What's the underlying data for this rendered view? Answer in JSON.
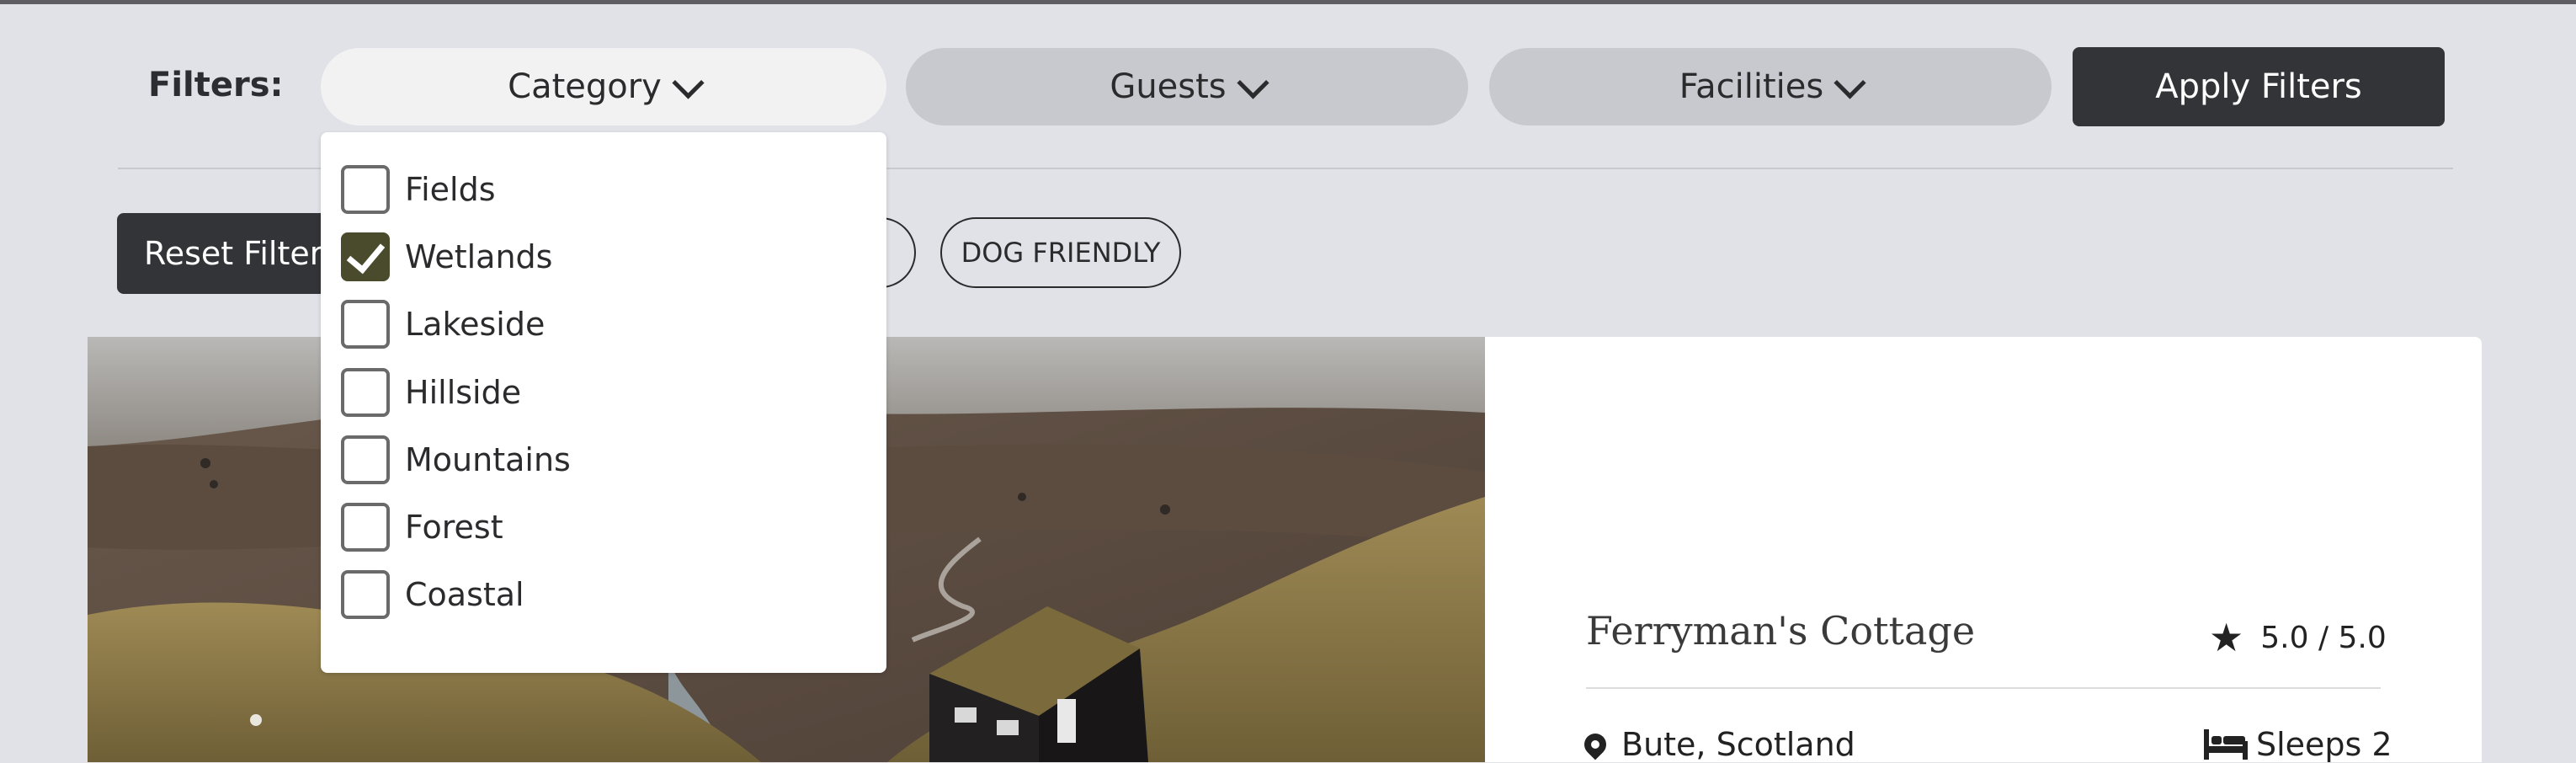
{
  "filters": {
    "label": "Filters:",
    "dropdowns": [
      {
        "label": "Category",
        "open": true
      },
      {
        "label": "Guests",
        "open": false
      },
      {
        "label": "Facilities",
        "open": false
      }
    ],
    "apply_label": "Apply Filters"
  },
  "active": {
    "reset_label": "Reset Filters",
    "tags": [
      "DOG FRIENDLY"
    ]
  },
  "category_options": [
    {
      "label": "Fields",
      "checked": false
    },
    {
      "label": "Wetlands",
      "checked": true
    },
    {
      "label": "Lakeside",
      "checked": false
    },
    {
      "label": "Hillside",
      "checked": false
    },
    {
      "label": "Mountains",
      "checked": false
    },
    {
      "label": "Forest",
      "checked": false
    },
    {
      "label": "Coastal",
      "checked": false
    }
  ],
  "listing": {
    "title": "Ferryman's Cottage",
    "rating": "5.0 / 5.0",
    "location": "Bute, Scotland",
    "sleeps": "Sleeps 2",
    "icons": {
      "rating": "star-icon",
      "location": "map-pin-icon",
      "sleeps": "bed-icon"
    }
  },
  "colors": {
    "background": "#e1e2e7",
    "pill": "#c8c9ce",
    "dark_button": "#333437",
    "checkbox_checked": "#4a4b2c"
  }
}
